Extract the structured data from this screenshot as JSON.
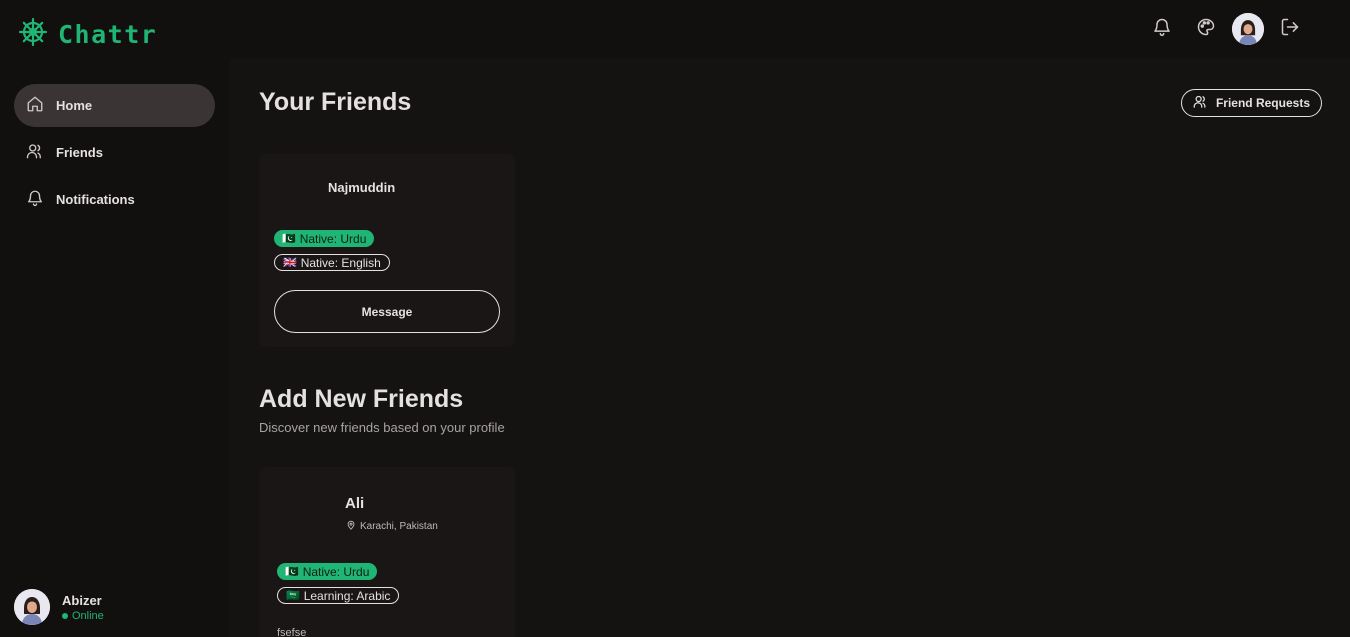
{
  "app": {
    "name": "Chattr",
    "accent": "#1fb574"
  },
  "sidebar": {
    "items": [
      {
        "label": "Home",
        "icon": "home-icon",
        "active": true
      },
      {
        "label": "Friends",
        "icon": "users-icon"
      },
      {
        "label": "Notifications",
        "icon": "bell-icon"
      }
    ],
    "user": {
      "name": "Abizer",
      "status": "Online"
    }
  },
  "topbar": {
    "icons": [
      "bell-icon",
      "palette-icon",
      "avatar",
      "logout-icon"
    ]
  },
  "friends": {
    "title": "Your Friends",
    "requests_label": "Friend Requests",
    "cards": [
      {
        "name": "Najmuddin",
        "languages": [
          {
            "flag": "🇵🇰",
            "text": "Native: Urdu",
            "style": "filled"
          },
          {
            "flag": "🇬🇧",
            "text": "Native: English",
            "style": "outline"
          }
        ],
        "button": "Message"
      }
    ]
  },
  "discover": {
    "title": "Add New Friends",
    "subtitle": "Discover new friends based on your profile",
    "cards": [
      {
        "name": "Ali",
        "location": "Karachi, Pakistan",
        "languages": [
          {
            "flag": "🇵🇰",
            "text": "Native: Urdu",
            "style": "filled"
          },
          {
            "flag": "🇸🇦",
            "text": "Learning: Arabic",
            "style": "outline"
          }
        ],
        "bio": "fsefse"
      }
    ]
  }
}
